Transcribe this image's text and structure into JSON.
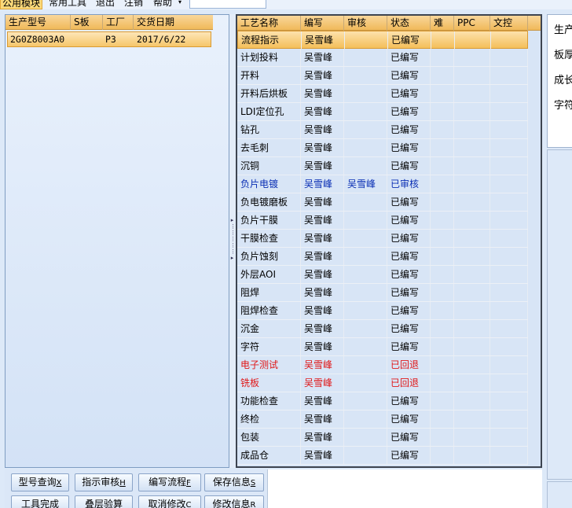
{
  "menubar": {
    "items": [
      "公用模块",
      "常用工具",
      "退出",
      "注销",
      "帮助"
    ],
    "combo_arrow": "▾"
  },
  "model_grid": {
    "headers": [
      "生产型号",
      "S板",
      "工厂",
      "交货日期"
    ],
    "rows": [
      {
        "model": "2G0Z8003A0",
        "s": "",
        "factory": "P3",
        "date": "2017/6/22"
      }
    ]
  },
  "process_grid": {
    "headers": [
      "工艺名称",
      "编写",
      "审核",
      "状态",
      "难",
      "PPC",
      "文控"
    ],
    "rows": [
      {
        "name": "流程指示",
        "writer": "吴雪峰",
        "reviewer": "",
        "status": "已编写",
        "style": "sel"
      },
      {
        "name": "计划投料",
        "writer": "吴雪峰",
        "reviewer": "",
        "status": "已编写",
        "style": ""
      },
      {
        "name": "开料",
        "writer": "吴雪峰",
        "reviewer": "",
        "status": "已编写",
        "style": ""
      },
      {
        "name": "开料后烘板",
        "writer": "吴雪峰",
        "reviewer": "",
        "status": "已编写",
        "style": ""
      },
      {
        "name": "LDI定位孔",
        "writer": "吴雪峰",
        "reviewer": "",
        "status": "已编写",
        "style": ""
      },
      {
        "name": "钻孔",
        "writer": "吴雪峰",
        "reviewer": "",
        "status": "已编写",
        "style": ""
      },
      {
        "name": "去毛刺",
        "writer": "吴雪峰",
        "reviewer": "",
        "status": "已编写",
        "style": ""
      },
      {
        "name": "沉铜",
        "writer": "吴雪峰",
        "reviewer": "",
        "status": "已编写",
        "style": ""
      },
      {
        "name": "负片电镀",
        "writer": "吴雪峰",
        "reviewer": "吴雪峰",
        "status": "已审核",
        "style": "blue"
      },
      {
        "name": "负电镀磨板",
        "writer": "吴雪峰",
        "reviewer": "",
        "status": "已编写",
        "style": ""
      },
      {
        "name": "负片干膜",
        "writer": "吴雪峰",
        "reviewer": "",
        "status": "已编写",
        "style": ""
      },
      {
        "name": "干膜检查",
        "writer": "吴雪峰",
        "reviewer": "",
        "status": "已编写",
        "style": ""
      },
      {
        "name": "负片蚀刻",
        "writer": "吴雪峰",
        "reviewer": "",
        "status": "已编写",
        "style": ""
      },
      {
        "name": "外层AOI",
        "writer": "吴雪峰",
        "reviewer": "",
        "status": "已编写",
        "style": ""
      },
      {
        "name": "阻焊",
        "writer": "吴雪峰",
        "reviewer": "",
        "status": "已编写",
        "style": ""
      },
      {
        "name": "阻焊检查",
        "writer": "吴雪峰",
        "reviewer": "",
        "status": "已编写",
        "style": ""
      },
      {
        "name": "沉金",
        "writer": "吴雪峰",
        "reviewer": "",
        "status": "已编写",
        "style": ""
      },
      {
        "name": "字符",
        "writer": "吴雪峰",
        "reviewer": "",
        "status": "已编写",
        "style": ""
      },
      {
        "name": "电子测试",
        "writer": "吴雪峰",
        "reviewer": "",
        "status": "已回退",
        "style": "red"
      },
      {
        "name": "铣板",
        "writer": "吴雪峰",
        "reviewer": "",
        "status": "已回退",
        "style": "red"
      },
      {
        "name": "功能检查",
        "writer": "吴雪峰",
        "reviewer": "",
        "status": "已编写",
        "style": ""
      },
      {
        "name": "终检",
        "writer": "吴雪峰",
        "reviewer": "",
        "status": "已编写",
        "style": ""
      },
      {
        "name": "包装",
        "writer": "吴雪峰",
        "reviewer": "",
        "status": "已编写",
        "style": ""
      },
      {
        "name": "成品仓",
        "writer": "吴雪峰",
        "reviewer": "",
        "status": "已编写",
        "style": ""
      }
    ]
  },
  "info_panel": {
    "labels": [
      "生产",
      "板厚",
      "成长",
      "字符"
    ]
  },
  "buttons": [
    {
      "label": "型号查询",
      "key": "X"
    },
    {
      "label": "指示审核",
      "key": "H"
    },
    {
      "label": "编写流程",
      "key": "F"
    },
    {
      "label": "保存信息",
      "key": "S"
    },
    {
      "label": "工具完成",
      "key": ""
    },
    {
      "label": "叠层验算",
      "key": ""
    },
    {
      "label": "取消修改",
      "key": "C"
    },
    {
      "label": "修改信息",
      "key": "R"
    }
  ],
  "colors": {
    "selected_row": "#f6c66a",
    "reviewed_text": "#0a2fb4",
    "rollback_text": "#e01818",
    "header_gold": "#f0b95a"
  }
}
